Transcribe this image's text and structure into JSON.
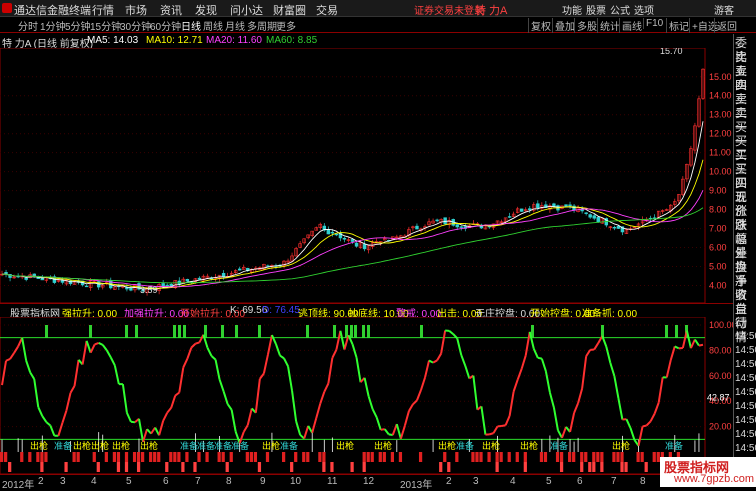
{
  "app": {
    "name": "通达信金融终端"
  },
  "menu": [
    "行情",
    "市场",
    "资讯",
    "发现",
    "问小达",
    "财富圈",
    "交易"
  ],
  "login_status": "证券交易未登录",
  "stock_title": "特 力A",
  "right_menu": [
    "功能",
    "股票",
    "公式",
    "选项",
    "游客"
  ],
  "period_tabs": [
    "分时",
    "1分钟",
    "5分钟",
    "15分钟",
    "30分钟",
    "60分钟",
    "日线",
    "周线",
    "月线",
    "多周期",
    "更多"
  ],
  "active_period": "日线",
  "right_toolbar": [
    "复权",
    "叠加",
    "多股",
    "统计",
    "画线",
    "F10",
    "标记",
    "+自选",
    "返回"
  ],
  "chart_header": {
    "title": "特 力A (日线 前复权)",
    "ma5": "MA5: 14.03",
    "ma10": "MA10: 12.71",
    "ma20": "MA20: 11.60",
    "ma60": "MA60: 8.85"
  },
  "price_axis": [
    "15.00",
    "14.00",
    "13.00",
    "12.00",
    "11.00",
    "10.00",
    "9.00",
    "8.00",
    "7.00",
    "6.00",
    "5.00",
    "4.00"
  ],
  "high_label": "15.70",
  "low_label": "3.59",
  "indicator_header": {
    "name": "股票指标网",
    "items": [
      {
        "text": "强拉升: 0.00",
        "color": "#ffff00"
      },
      {
        "text": "加强拉升: 0.00",
        "color": "#ff40ff"
      },
      {
        "text": "开始拉升: 0.00",
        "color": "#ff4040"
      },
      {
        "text": "K: 69.56",
        "color": "#dddddd"
      },
      {
        "text": "D: 76.45",
        "color": "#4040ff"
      },
      {
        "text": "逃顶线: 90.00",
        "color": "#ffff00"
      },
      {
        "text": "抄底线: 10.00",
        "color": "#ffff00"
      },
      {
        "text": "警戒: 0.00",
        "color": "#ff40ff"
      },
      {
        "text": "出击: 0.00",
        "color": "#ffff00"
      },
      {
        "text": "无庄控盘: 0.00",
        "color": "#dddddd"
      },
      {
        "text": "开始控盘: 0.00",
        "color": "#ffff00"
      },
      {
        "text": "准备抓: 0.00",
        "color": "#ffff00"
      }
    ]
  },
  "indicator_axis": [
    "100.00",
    "80.00",
    "60.00",
    "40.00",
    "20.00"
  ],
  "indicator_value": "42.87",
  "signals": [
    {
      "text": "出枪"
    },
    {
      "text": "准备"
    },
    {
      "text": "出枪"
    },
    {
      "text": "出枪"
    },
    {
      "text": "出枪"
    },
    {
      "text": "出枪"
    },
    {
      "text": "准备"
    },
    {
      "text": "准备"
    },
    {
      "text": "准备"
    },
    {
      "text": "准备"
    },
    {
      "text": "出枪"
    },
    {
      "text": "准备"
    },
    {
      "text": "出枪"
    },
    {
      "text": "出枪"
    },
    {
      "text": "出枪"
    },
    {
      "text": "准备"
    },
    {
      "text": "出枪"
    },
    {
      "text": "出枪"
    },
    {
      "text": "准备"
    },
    {
      "text": "出枪"
    },
    {
      "text": "准备"
    }
  ],
  "time_labels": [
    "2012年",
    "2",
    "3",
    "4",
    "5",
    "6",
    "7",
    "8",
    "9",
    "10",
    "11",
    "12",
    "2013年",
    "2",
    "3",
    "4",
    "5",
    "6",
    "7",
    "8",
    "9"
  ],
  "side_panel": [
    "委比",
    "卖五",
    "卖四",
    "卖三",
    "卖二",
    "卖一",
    "买一",
    "买二",
    "买三",
    "买四",
    "买五",
    "现价",
    "涨跌",
    "涨幅",
    "总量",
    "外盘",
    "换手",
    "净资",
    "收益",
    "自动",
    "行情",
    "14:50",
    "14:50",
    "14:50",
    "14:50",
    "14:50",
    "14:50",
    "14:50",
    "14:50",
    "14:50"
  ],
  "watermark": {
    "line1": "股票指标网",
    "line2": "www.7gpzb.com"
  },
  "colors": {
    "up": "#ff3030",
    "down": "#30ff30",
    "ma5": "#ffffff",
    "ma10": "#ffff00",
    "ma20": "#ff40ff",
    "ma60": "#30d030",
    "grid": "#8b0000"
  }
}
